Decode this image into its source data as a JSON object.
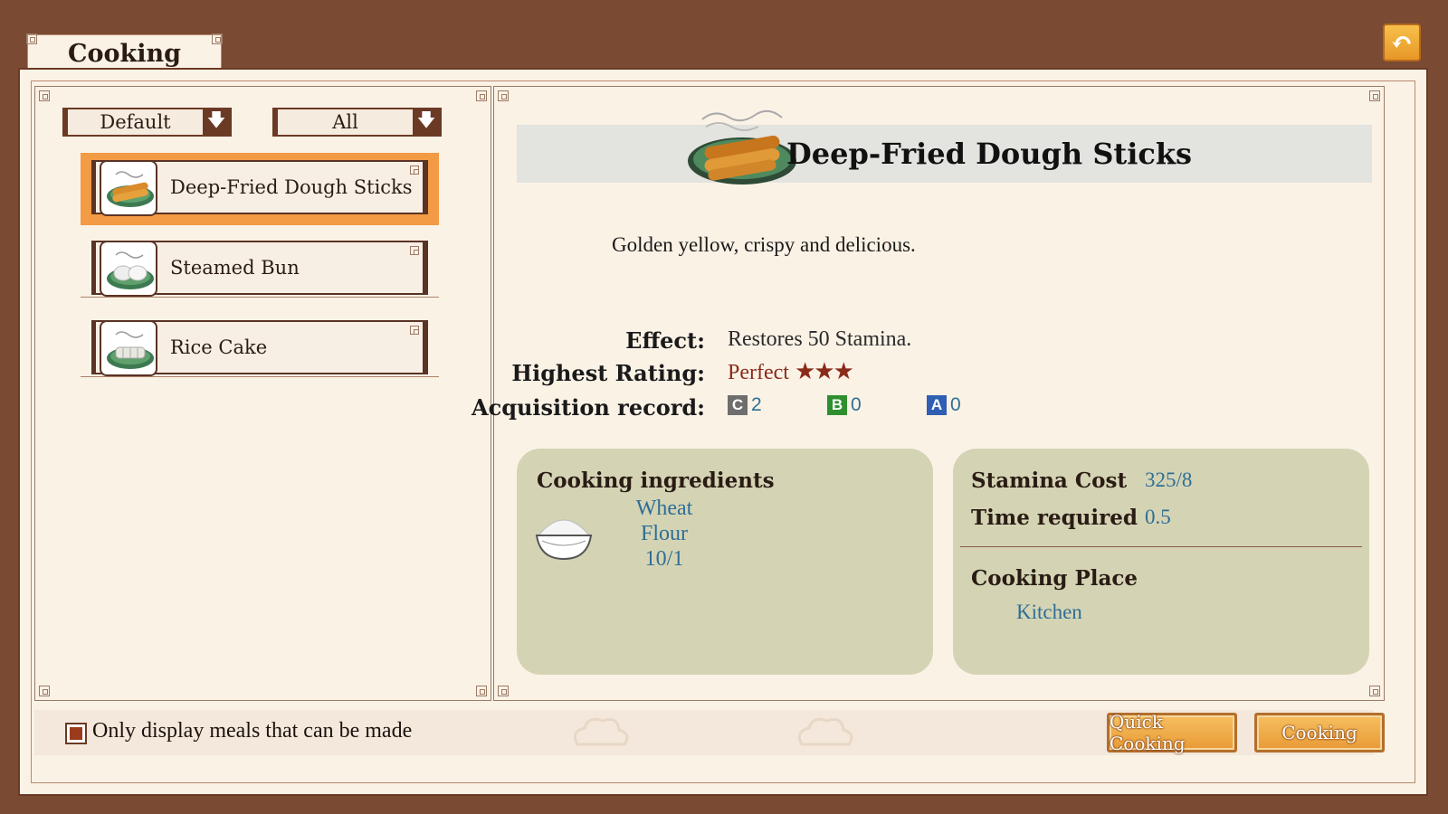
{
  "window": {
    "title": "Cooking"
  },
  "filters": {
    "sort_label": "Default",
    "category_label": "All"
  },
  "recipes": [
    {
      "name": "Deep-Fried Dough Sticks",
      "selected": true,
      "icon": "dough-sticks-icon"
    },
    {
      "name": "Steamed Bun",
      "selected": false,
      "icon": "steamed-bun-icon"
    },
    {
      "name": "Rice Cake",
      "selected": false,
      "icon": "rice-cake-icon"
    }
  ],
  "detail": {
    "title": "Deep-Fried Dough Sticks",
    "description": "Golden yellow, crispy and delicious.",
    "effect_label": "Effect:",
    "effect_value": "Restores 50 Stamina.",
    "rating_label": "Highest Rating:",
    "rating_value": "Perfect",
    "rating_stars": "★★★",
    "acquisition_label": "Acquisition record:",
    "acquisition": [
      {
        "grade": "C",
        "count": "2",
        "color": "#6e6e6e"
      },
      {
        "grade": "B",
        "count": "0",
        "color": "#2f8f2f"
      },
      {
        "grade": "A",
        "count": "0",
        "color": "#2f5fb3"
      }
    ]
  },
  "ingredients": {
    "heading": "Cooking ingredients",
    "items": [
      {
        "name_line1": "Wheat",
        "name_line2": "Flour",
        "quantity": "10/1",
        "icon": "flour-bowl-icon"
      }
    ]
  },
  "stats": {
    "stamina_label": "Stamina Cost",
    "stamina_value": "325/8",
    "time_label": "Time required",
    "time_value": "0.5",
    "place_label": "Cooking Place",
    "place_value": "Kitchen"
  },
  "footer": {
    "checkbox_label": "Only display meals that can be made",
    "checkbox_checked": true,
    "quick_cooking_label": "Quick Cooking",
    "cooking_label": "Cooking"
  },
  "colors": {
    "accent": "#f29a44",
    "frame": "#7a4a33",
    "value_text": "#2f6e94",
    "rating": "#8a2b1a"
  }
}
